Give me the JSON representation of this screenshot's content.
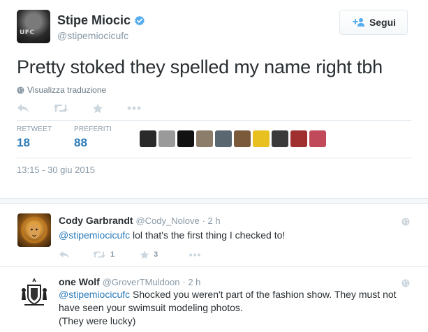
{
  "tweet": {
    "author_name": "Stipe Miocic",
    "author_handle": "@stipemiocicufc",
    "avatar_text": "UFC",
    "follow_label": "Segui",
    "text": "Pretty stoked they spelled my name right tbh",
    "translate_label": "Visualizza traduzione",
    "stats": {
      "retweets_label": "RETWEET",
      "retweets": "18",
      "favorites_label": "PREFERITI",
      "favorites": "88"
    },
    "favoriter_avatars": [
      "#2a2a2a",
      "#9a9a9a",
      "#111111",
      "#8c7c6a",
      "#5a6670",
      "#7a5a3a",
      "#e8c020",
      "#3a3a3a",
      "#a03030",
      "#c04a5a"
    ],
    "timestamp": "13:15 - 30 giu 2015"
  },
  "replies": [
    {
      "name": "Cody Garbrandt",
      "handle": "@Cody_Nolove",
      "time": "· 2 h",
      "mention": "@stipemiocicufc",
      "text": " lol that's the first thing I checked to!",
      "retweets": "1",
      "favorites": "3"
    },
    {
      "name": "one Wolf",
      "handle": "@GroverTMuldoon",
      "time": "· 2 h",
      "mention": "@stipemiocicufc",
      "text": " Shocked you weren't part of the fashion show. They must not have seen your swimsuit modeling photos.",
      "text_line2": "(They were lucky)"
    }
  ],
  "colors": {
    "link": "#2b7bb9",
    "muted": "#8899a6",
    "verified": "#55acee",
    "text": "#292f33"
  }
}
